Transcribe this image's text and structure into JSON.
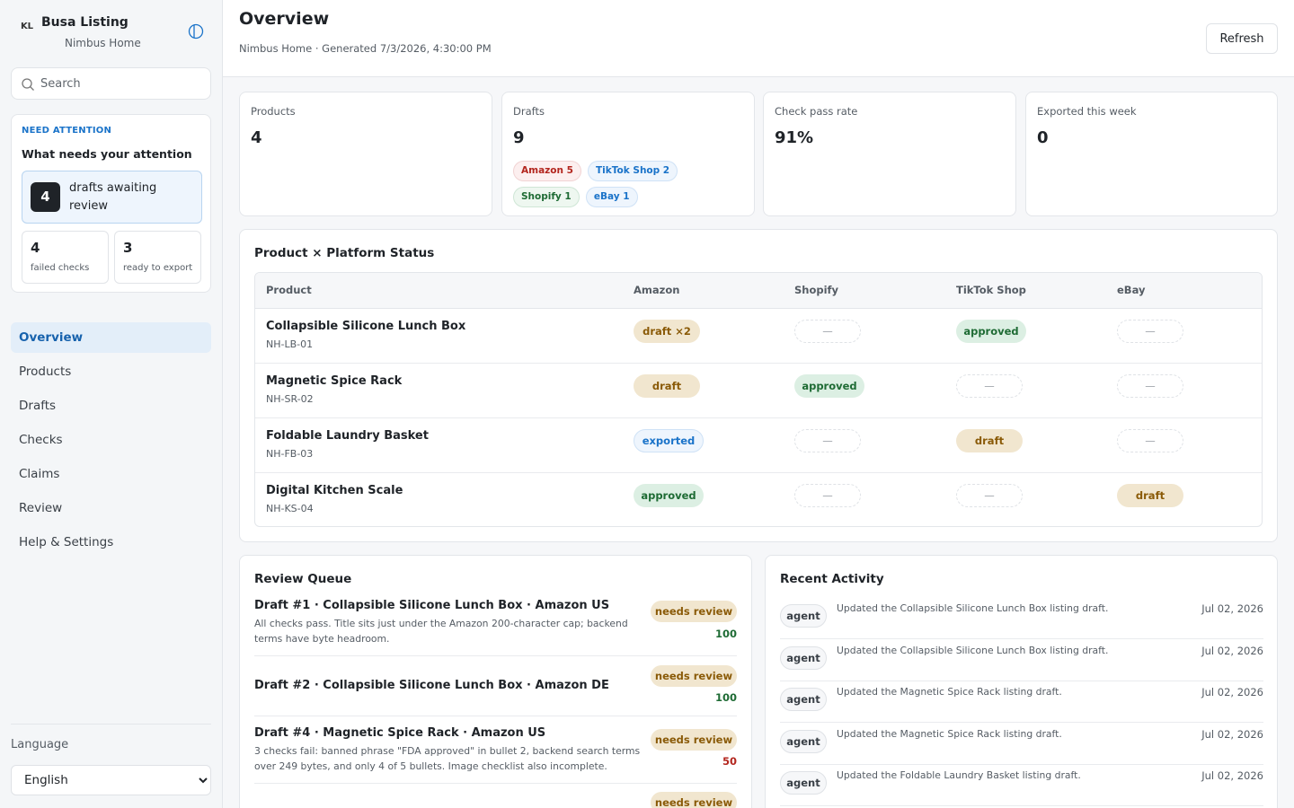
{
  "brand": {
    "badge": "KL",
    "title": "Busa Listing",
    "subtitle": "Nimbus Home"
  },
  "search": {
    "placeholder": "Search"
  },
  "attention": {
    "kicker": "NEED ATTENTION",
    "title": "What needs your attention",
    "main": {
      "count": "4",
      "label": "drafts awaiting review"
    },
    "failed": {
      "count": "4",
      "label": "failed checks"
    },
    "ready": {
      "count": "3",
      "label": "ready to export"
    }
  },
  "nav": [
    {
      "label": "Overview",
      "active": true
    },
    {
      "label": "Products"
    },
    {
      "label": "Drafts"
    },
    {
      "label": "Checks"
    },
    {
      "label": "Claims"
    },
    {
      "label": "Review"
    },
    {
      "label": "Help & Settings"
    }
  ],
  "language": {
    "label": "Language",
    "selected": "English"
  },
  "header": {
    "title": "Overview",
    "subtitle": "Nimbus Home · Generated 7/3/2026, 4:30:00 PM",
    "refresh_label": "Refresh"
  },
  "stats": {
    "products": {
      "label": "Products",
      "value": "4"
    },
    "drafts": {
      "label": "Drafts",
      "value": "9",
      "chips": [
        {
          "label": "Amazon 5",
          "kind": "amazon"
        },
        {
          "label": "TikTok Shop 2",
          "kind": "tiktok"
        },
        {
          "label": "Shopify 1",
          "kind": "shopify"
        },
        {
          "label": "eBay 1",
          "kind": "ebay"
        }
      ]
    },
    "pass_rate": {
      "label": "Check pass rate",
      "value": "91%"
    },
    "exported": {
      "label": "Exported this week",
      "value": "0"
    }
  },
  "matrix": {
    "title": "Product × Platform Status",
    "columns": [
      "Product",
      "Amazon",
      "Shopify",
      "TikTok Shop",
      "eBay"
    ],
    "rows": [
      {
        "name": "Collapsible Silicone Lunch Box",
        "sku": "NH-LB-01",
        "cells": [
          {
            "label": "draft ×2",
            "status": "draft"
          },
          {
            "label": "—",
            "status": "empty"
          },
          {
            "label": "approved",
            "status": "approved"
          },
          {
            "label": "—",
            "status": "empty"
          }
        ]
      },
      {
        "name": "Magnetic Spice Rack",
        "sku": "NH-SR-02",
        "cells": [
          {
            "label": "draft",
            "status": "draft"
          },
          {
            "label": "approved",
            "status": "approved"
          },
          {
            "label": "—",
            "status": "empty"
          },
          {
            "label": "—",
            "status": "empty"
          }
        ]
      },
      {
        "name": "Foldable Laundry Basket",
        "sku": "NH-FB-03",
        "cells": [
          {
            "label": "exported",
            "status": "exported"
          },
          {
            "label": "—",
            "status": "empty"
          },
          {
            "label": "draft",
            "status": "draft"
          },
          {
            "label": "—",
            "status": "empty"
          }
        ]
      },
      {
        "name": "Digital Kitchen Scale",
        "sku": "NH-KS-04",
        "cells": [
          {
            "label": "approved",
            "status": "approved"
          },
          {
            "label": "—",
            "status": "empty"
          },
          {
            "label": "—",
            "status": "empty"
          },
          {
            "label": "draft",
            "status": "draft"
          }
        ]
      }
    ]
  },
  "queue": {
    "title": "Review Queue",
    "items": [
      {
        "title": "Draft #1 · Collapsible Silicone Lunch Box · Amazon US",
        "desc": "All checks pass. Title sits just under the Amazon 200-character cap; backend terms have byte headroom.",
        "badge": "needs review",
        "score": "100",
        "score_tone": "good"
      },
      {
        "title": "Draft #2 · Collapsible Silicone Lunch Box · Amazon DE",
        "desc": "",
        "badge": "needs review",
        "score": "100",
        "score_tone": "good"
      },
      {
        "title": "Draft #4 · Magnetic Spice Rack · Amazon US",
        "desc": "3 checks fail: banned phrase \"FDA approved\" in bullet 2, backend search terms over 249 bytes, and only 4 of 5 bullets. Image checklist also incomplete.",
        "badge": "needs review",
        "score": "50",
        "score_tone": "bad"
      },
      {
        "title": "",
        "desc": "",
        "badge": "needs review",
        "score": "",
        "score_tone": "good"
      }
    ]
  },
  "activity": {
    "title": "Recent Activity",
    "items": [
      {
        "actor": "agent",
        "text": "Updated the Collapsible Silicone Lunch Box listing draft.",
        "date": "Jul 02, 2026"
      },
      {
        "actor": "agent",
        "text": "Updated the Collapsible Silicone Lunch Box listing draft.",
        "date": "Jul 02, 2026"
      },
      {
        "actor": "agent",
        "text": "Updated the Magnetic Spice Rack listing draft.",
        "date": "Jul 02, 2026"
      },
      {
        "actor": "agent",
        "text": "Updated the Magnetic Spice Rack listing draft.",
        "date": "Jul 02, 2026"
      },
      {
        "actor": "agent",
        "text": "Updated the Foldable Laundry Basket listing draft.",
        "date": "Jul 02, 2026"
      }
    ]
  },
  "colors": {
    "accent": "#1a73c9",
    "draft": "#8a5a07",
    "approved": "#1e6b34",
    "danger": "#b3261e"
  },
  "icons": {
    "panel": "sidebar-toggle-icon",
    "search": "search-icon"
  }
}
